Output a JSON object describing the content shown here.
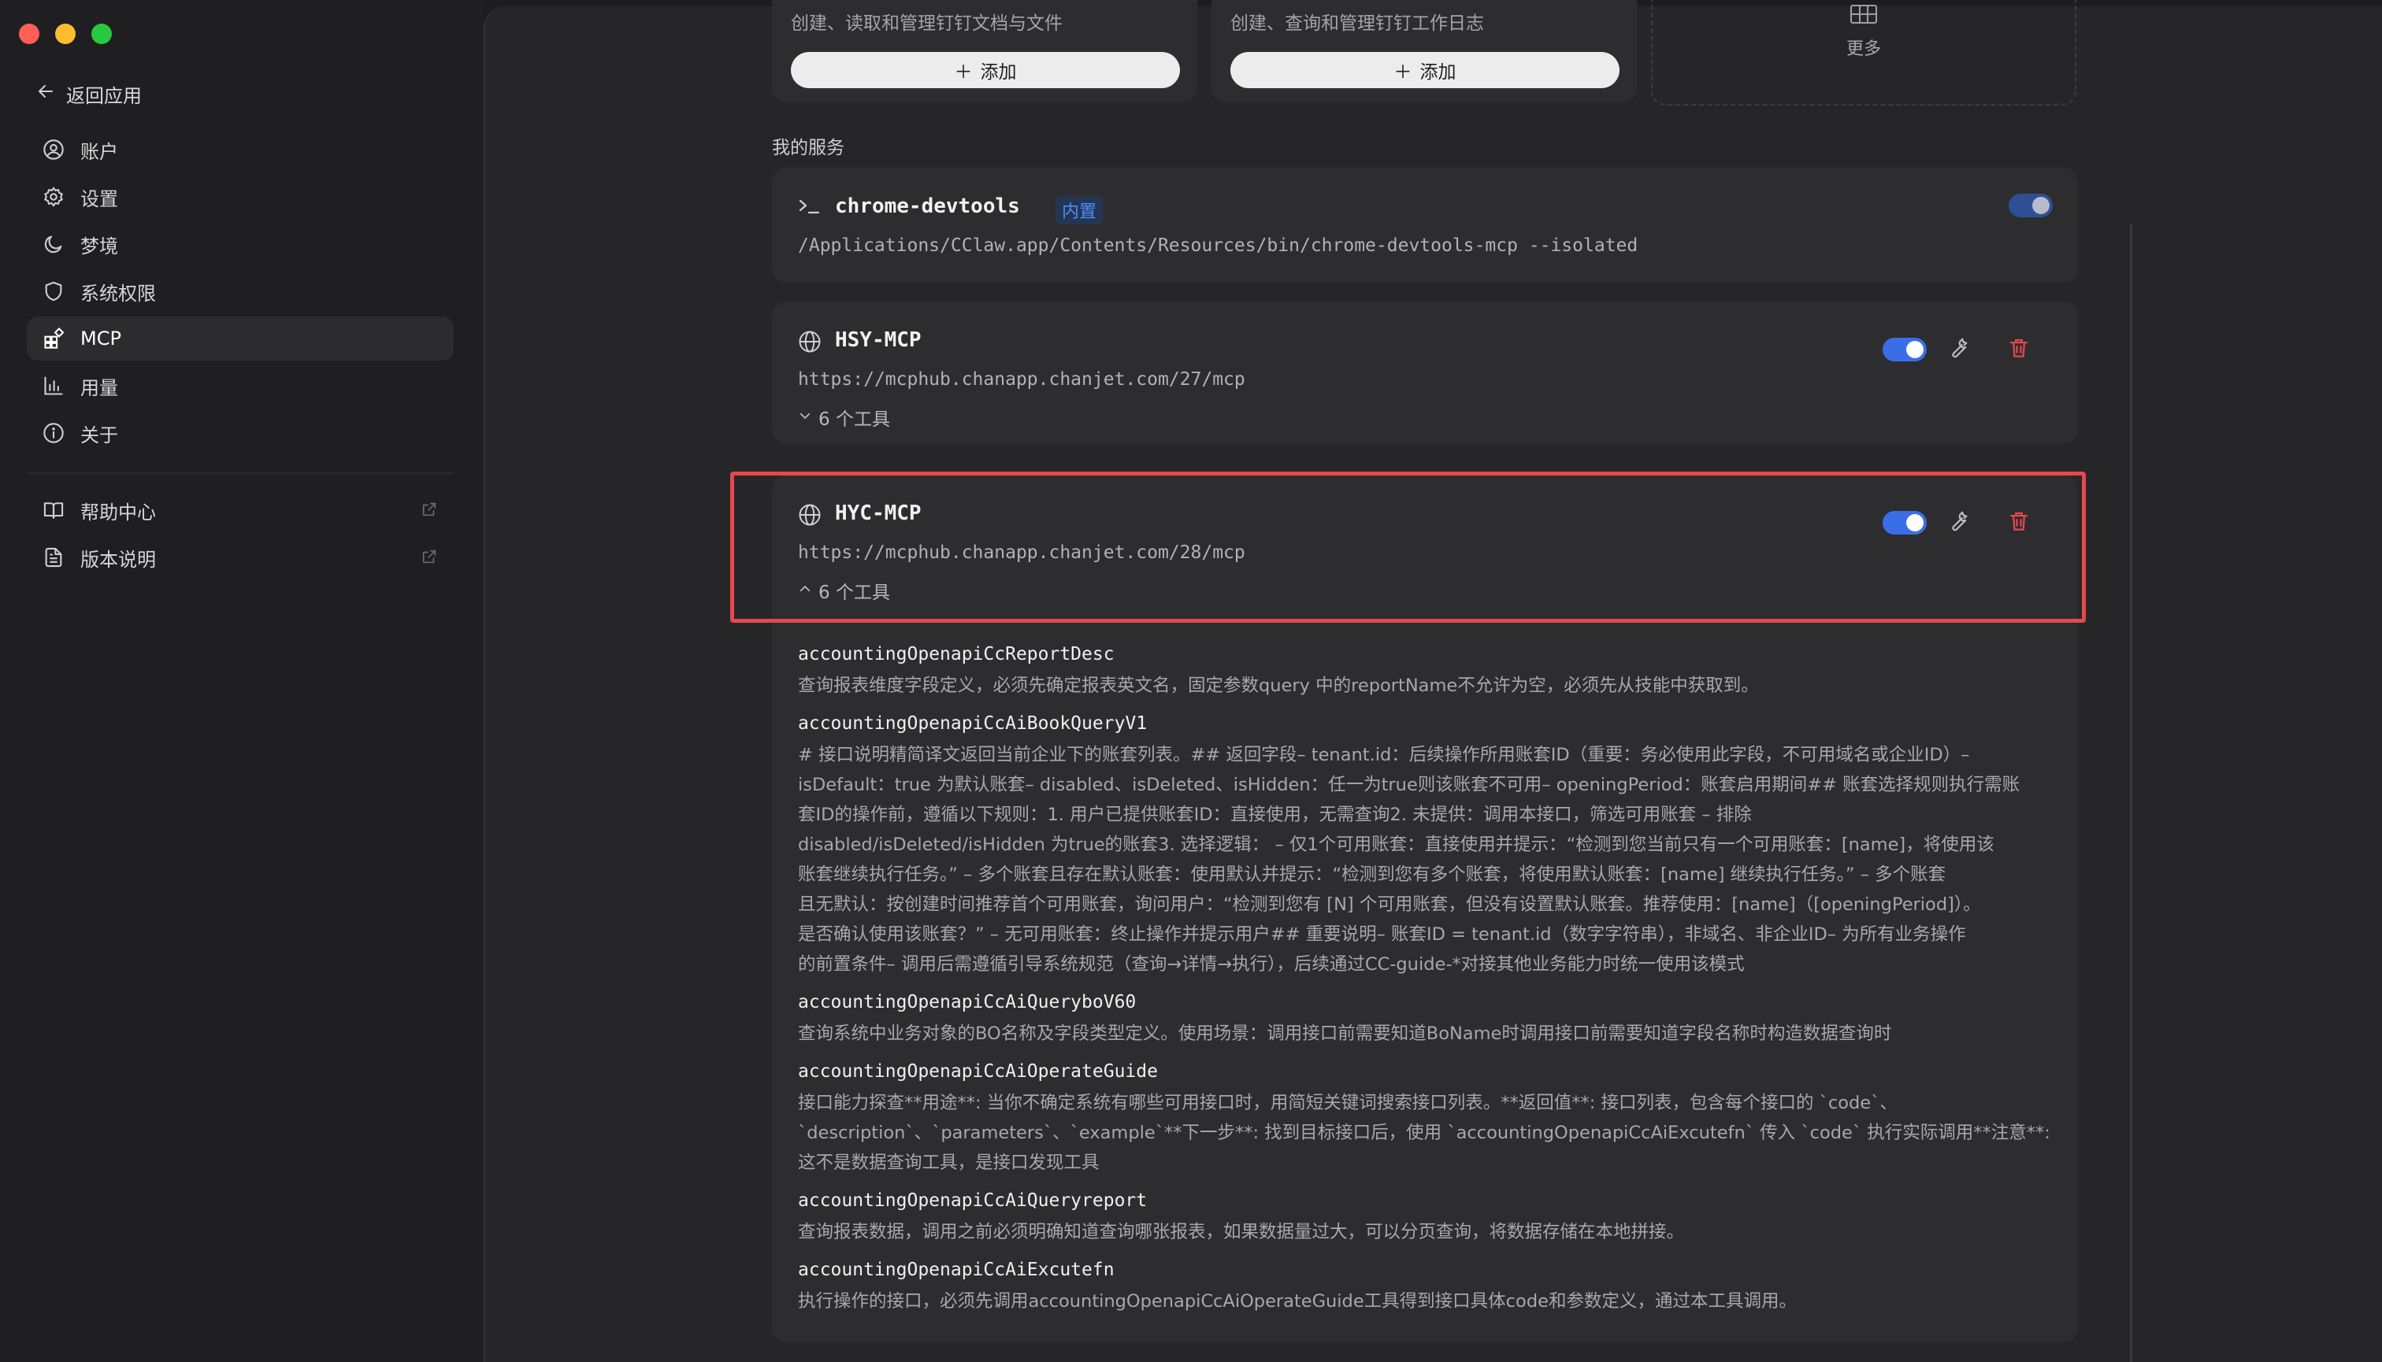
{
  "window": {
    "light_colors": [
      "#fe5f57",
      "#febc2e",
      "#28c840"
    ]
  },
  "sidebar": {
    "back_label": "返回应用",
    "items": [
      {
        "label": "账户",
        "icon": "user-circle-icon"
      },
      {
        "label": "设置",
        "icon": "gear-icon"
      },
      {
        "label": "梦境",
        "icon": "moon-icon"
      },
      {
        "label": "系统权限",
        "icon": "shield-icon"
      },
      {
        "label": "MCP",
        "icon": "mcp-grid-icon",
        "active": true
      },
      {
        "label": "用量",
        "icon": "bar-chart-icon"
      },
      {
        "label": "关于",
        "icon": "info-icon"
      }
    ],
    "links": [
      {
        "label": "帮助中心",
        "icon": "book-icon"
      },
      {
        "label": "版本说明",
        "icon": "document-icon"
      }
    ]
  },
  "market": {
    "cards": [
      {
        "desc": "创建、读取和管理钉钉文档与文件",
        "add_label": "添加"
      },
      {
        "desc": "创建、查询和管理钉钉工作日志",
        "add_label": "添加"
      }
    ],
    "more_label": "更多"
  },
  "services": {
    "heading": "我的服务",
    "items": [
      {
        "name": "chrome-devtools",
        "badge": "内置",
        "command": "/Applications/CClaw.app/Contents/Resources/bin/chrome-devtools-mcp --isolated",
        "enabled": true
      },
      {
        "name": "HSY-MCP",
        "url": "https://mcphub.chanapp.chanjet.com/27/mcp",
        "tools_label": "6 个工具",
        "enabled": true,
        "expanded": false
      },
      {
        "name": "HYC-MCP",
        "url": "https://mcphub.chanapp.chanjet.com/28/mcp",
        "tools_label": "6 个工具",
        "enabled": true,
        "expanded": true
      }
    ]
  },
  "tools": [
    {
      "name": "accountingOpenapiCcReportDesc",
      "lines": [
        "查询报表维度字段定义，必须先确定报表英文名，固定参数query 中的reportName不允许为空，必须先从技能中获取到。"
      ]
    },
    {
      "name": "accountingOpenapiCcAiBookQueryV1",
      "lines": [
        "# 接口说明精简译文返回当前企业下的账套列表。## 返回字段– tenant.id：后续操作所用账套ID（重要：务必使用此字段，不可用域名或企业ID）–",
        "isDefault：true 为默认账套– disabled、isDeleted、isHidden：任一为true则该账套不可用– openingPeriod：账套启用期间## 账套选择规则执行需账",
        "套ID的操作前，遵循以下规则：1. 用户已提供账套ID：直接使用，无需查询2. 未提供：调用本接口，筛选可用账套 – 排除",
        "disabled/isDeleted/isHidden 为true的账套3. 选择逻辑： – 仅1个可用账套：直接使用并提示：“检测到您当前只有一个可用账套：[name]，将使用该",
        "账套继续执行任务。” – 多个账套且存在默认账套：使用默认并提示：“检测到您有多个账套，将使用默认账套：[name] 继续执行任务。” – 多个账套",
        "且无默认：按创建时间推荐首个可用账套，询问用户：“检测到您有 [N] 个可用账套，但没有设置默认账套。推荐使用：[name]（[openingPeriod]）。",
        "是否确认使用该账套？” – 无可用账套：终止操作并提示用户## 重要说明– 账套ID = tenant.id（数字字符串），非域名、非企业ID– 为所有业务操作",
        "的前置条件– 调用后需遵循引导系统规范（查询→详情→执行），后续通过CC-guide-*对接其他业务能力时统一使用该模式"
      ]
    },
    {
      "name": "accountingOpenapiCcAiQueryboV60",
      "lines": [
        "查询系统中业务对象的BO名称及字段类型定义。使用场景：调用接口前需要知道BoName时调用接口前需要知道字段名称时构造数据查询时"
      ]
    },
    {
      "name": "accountingOpenapiCcAiOperateGuide",
      "lines": [
        "接口能力探查**用途**: 当你不确定系统有哪些可用接口时，用简短关键词搜索接口列表。**返回值**: 接口列表，包含每个接口的 `code`、",
        "`description`、`parameters`、`example`**下一步**: 找到目标接口后，使用 `accountingOpenapiCcAiExcutefn` 传入 `code` 执行实际调用**注意**:",
        "这不是数据查询工具，是接口发现工具"
      ]
    },
    {
      "name": "accountingOpenapiCcAiQueryreport",
      "lines": [
        "查询报表数据，调用之前必须明确知道查询哪张报表，如果数据量过大，可以分页查询，将数据存储在本地拼接。"
      ]
    },
    {
      "name": "accountingOpenapiCcAiExcutefn",
      "lines": [
        "执行操作的接口，必须先调用accountingOpenapiCcAiOperateGuide工具得到接口具体code和参数定义，通过本工具调用。"
      ]
    }
  ]
}
